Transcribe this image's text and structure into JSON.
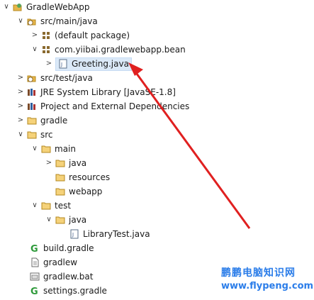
{
  "tree": {
    "items": [
      {
        "label": "GradleWebApp",
        "icon": "project-icon",
        "twisty": "expanded"
      },
      {
        "label": "src/main/java",
        "icon": "source-folder-icon",
        "twisty": "expanded"
      },
      {
        "label": "(default package)",
        "icon": "package-icon",
        "twisty": "collapsed"
      },
      {
        "label": "com.yiibai.gradlewebapp.bean",
        "icon": "package-icon",
        "twisty": "expanded"
      },
      {
        "label": "Greeting.java",
        "icon": "java-file-icon",
        "twisty": "collapsed",
        "selected": true
      },
      {
        "label": "src/test/java",
        "icon": "source-folder-icon",
        "twisty": "collapsed"
      },
      {
        "label": "JRE System Library [JavaSE-1.8]",
        "icon": "library-icon",
        "twisty": "collapsed"
      },
      {
        "label": "Project and External Dependencies",
        "icon": "library-icon",
        "twisty": "collapsed"
      },
      {
        "label": "gradle",
        "icon": "folder-icon",
        "twisty": "collapsed"
      },
      {
        "label": "src",
        "icon": "folder-icon",
        "twisty": "expanded"
      },
      {
        "label": "main",
        "icon": "folder-icon",
        "twisty": "expanded"
      },
      {
        "label": "java",
        "icon": "folder-icon",
        "twisty": "collapsed"
      },
      {
        "label": "resources",
        "icon": "folder-icon",
        "twisty": ""
      },
      {
        "label": "webapp",
        "icon": "folder-icon",
        "twisty": ""
      },
      {
        "label": "test",
        "icon": "folder-icon",
        "twisty": "expanded"
      },
      {
        "label": "java",
        "icon": "folder-icon",
        "twisty": "expanded"
      },
      {
        "label": "LibraryTest.java",
        "icon": "java-file-icon",
        "twisty": ""
      },
      {
        "label": "build.gradle",
        "icon": "gradle-icon",
        "twisty": ""
      },
      {
        "label": "gradlew",
        "icon": "file-icon",
        "twisty": ""
      },
      {
        "label": "gradlew.bat",
        "icon": "bat-file-icon",
        "twisty": ""
      },
      {
        "label": "settings.gradle",
        "icon": "gradle-icon",
        "twisty": ""
      }
    ]
  },
  "watermark": {
    "title": "鹏鹏电脑知识网",
    "url": "www.flypeng.com"
  },
  "colors": {
    "selection": "#dbe9f8",
    "arrow": "#e02020",
    "watermark": "#2b7de9",
    "folder": "#e8b74a",
    "package": "#8a6a2f",
    "gradle": "#2e9a3a"
  }
}
